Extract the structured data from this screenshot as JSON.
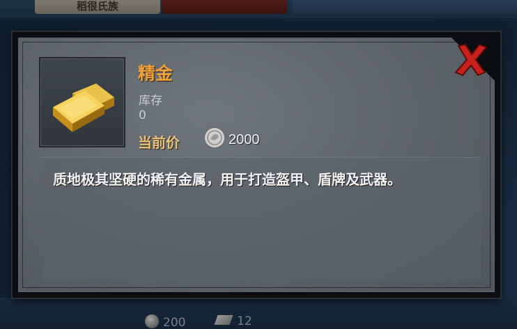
{
  "background": {
    "top_tab_left_label": "稻很氏族",
    "bottom_bar": {
      "coin_amount": "200",
      "metal_amount": "12"
    }
  },
  "dialog": {
    "item_name": "精金",
    "stock_label": "库存",
    "stock_value": "0",
    "price_label": "当前价",
    "price_value": "2000",
    "description": "质地极其坚硬的稀有金属，用于打造盔甲、盾牌及武器。",
    "icons": {
      "item": "gold-ingot-icon",
      "currency": "silver-coin-icon",
      "close": "close-x-icon"
    },
    "colors": {
      "item_name": "#f0a23a",
      "price_label": "#e9c27a",
      "close_red": "#c8201c"
    }
  }
}
